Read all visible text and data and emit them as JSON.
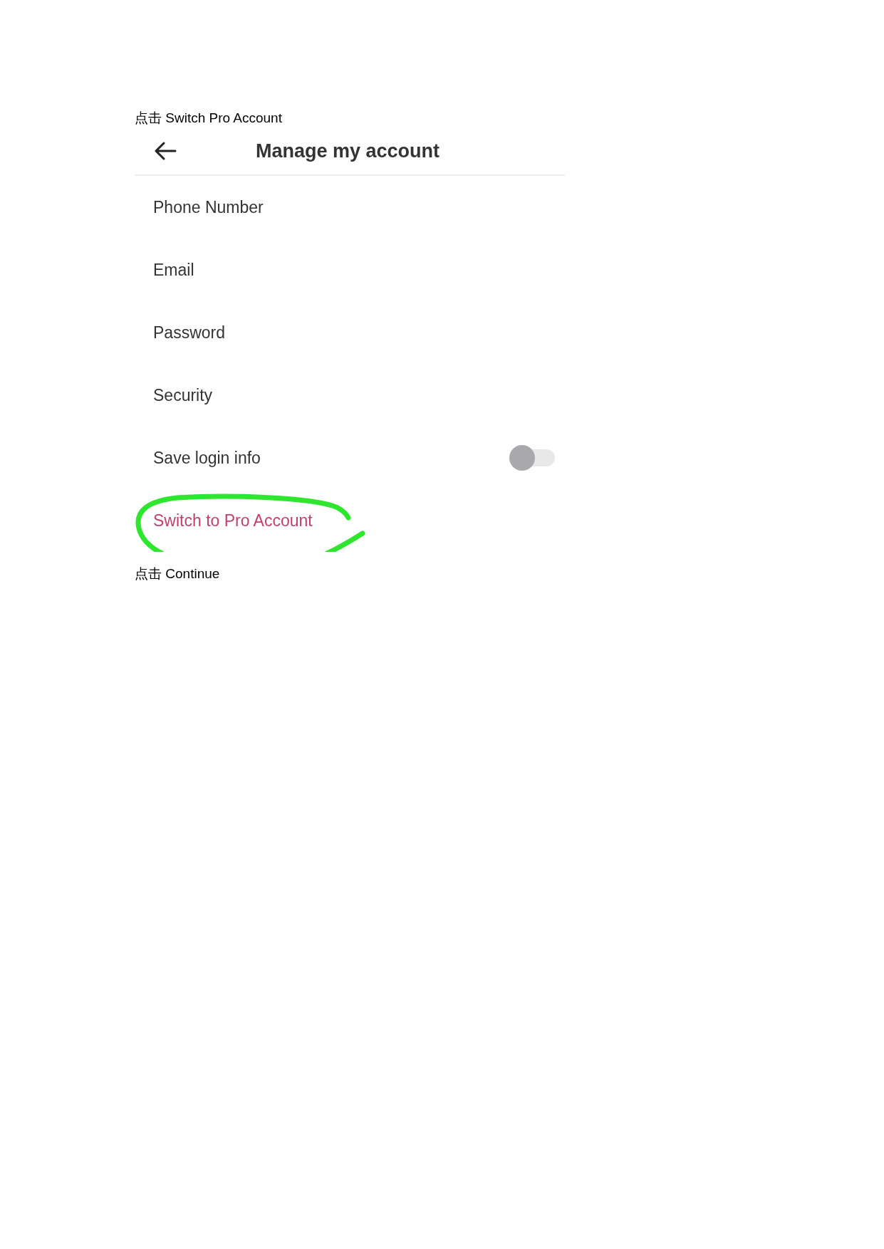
{
  "captions": [
    "点击 Switch Pro Account",
    "点击 Continue"
  ],
  "screen": {
    "title": "Manage my account",
    "items": [
      {
        "kind": "nav",
        "label": "Phone Number"
      },
      {
        "kind": "nav",
        "label": "Email"
      },
      {
        "kind": "nav",
        "label": "Password"
      },
      {
        "kind": "nav",
        "label": "Security"
      },
      {
        "kind": "toggle",
        "label": "Save login info",
        "on": false
      },
      {
        "kind": "link",
        "label": "Switch to Pro Account",
        "highlighted": true
      }
    ]
  }
}
